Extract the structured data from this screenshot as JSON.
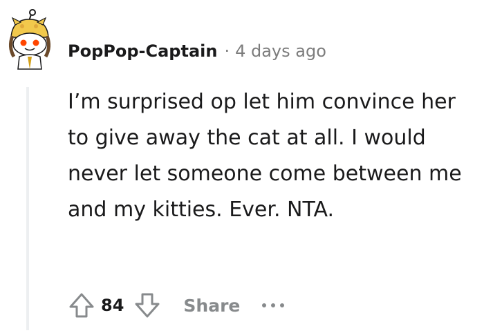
{
  "comment": {
    "author": "PopPop-Captain",
    "separator": "·",
    "timestamp": "4 days ago",
    "body": "I’m surprised op let him convince her to give away the cat at all. I would never let someone come between me and my kitties. Ever. NTA."
  },
  "actions": {
    "score": "84",
    "share_label": "Share",
    "upvote_icon": "arrow-up-icon",
    "downvote_icon": "arrow-down-icon",
    "more_icon": "more-options-icon"
  },
  "colors": {
    "text": "#1a1a1b",
    "muted": "#7c7c7c",
    "action_gray": "#878a8c",
    "thread_line": "#edeff1"
  }
}
